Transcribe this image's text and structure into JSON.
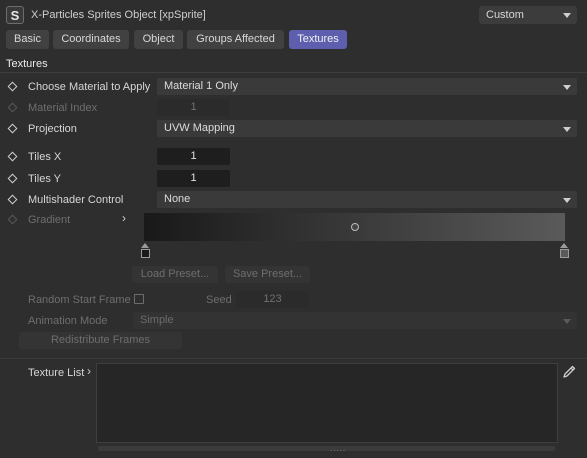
{
  "header": {
    "icon_letter": "S",
    "title": "X-Particles Sprites Object [xpSprite]",
    "preset": "Custom"
  },
  "tabs": [
    {
      "label": "Basic",
      "active": false
    },
    {
      "label": "Coordinates",
      "active": false
    },
    {
      "label": "Object",
      "active": false
    },
    {
      "label": "Groups Affected",
      "active": false
    },
    {
      "label": "Textures",
      "active": true
    }
  ],
  "section_title": "Textures",
  "params": {
    "choose_material": {
      "label": "Choose Material to Apply",
      "value": "Material 1 Only"
    },
    "material_index": {
      "label": "Material Index",
      "value": "1"
    },
    "projection": {
      "label": "Projection",
      "value": "UVW Mapping"
    },
    "tiles_x": {
      "label": "Tiles X",
      "value": "1"
    },
    "tiles_y": {
      "label": "Tiles Y",
      "value": "1"
    },
    "multishader": {
      "label": "Multishader Control",
      "value": "None"
    },
    "gradient": {
      "label": "Gradient"
    }
  },
  "buttons": {
    "load_preset": "Load Preset...",
    "save_preset": "Save Preset...",
    "redistribute": "Redistribute Frames"
  },
  "animation": {
    "random_start_label": "Random Start Frame",
    "random_start_checked": false,
    "seed_label": "Seed",
    "seed_value": "123",
    "mode_label": "Animation Mode",
    "mode_value": "Simple"
  },
  "texture_list": {
    "label": "Texture List",
    "grip": "....."
  },
  "colors": {
    "active_tab": "#5d5fae",
    "background": "#2e2e2e"
  }
}
